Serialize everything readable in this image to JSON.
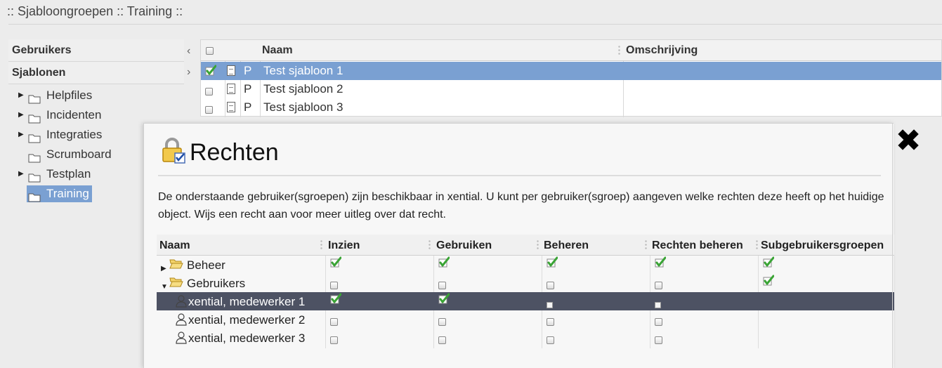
{
  "page": {
    "title": ":: Sjabloongroepen :: Training ::"
  },
  "nav": {
    "sections": [
      "Gebruikers",
      "Sjablonen"
    ],
    "items": [
      {
        "label": "Helpfiles",
        "expandable": true,
        "selected": false
      },
      {
        "label": "Incidenten",
        "expandable": true,
        "selected": false
      },
      {
        "label": "Integraties",
        "expandable": true,
        "selected": false
      },
      {
        "label": "Scrumboard",
        "expandable": false,
        "selected": false
      },
      {
        "label": "Testplan",
        "expandable": true,
        "selected": false
      },
      {
        "label": "Training",
        "expandable": false,
        "selected": true
      }
    ]
  },
  "grid": {
    "columns": {
      "name": "Naam",
      "description": "Omschrijving"
    },
    "rows": [
      {
        "type": "P",
        "name": "Test sjabloon 1",
        "description": "",
        "checked": true,
        "selected": true
      },
      {
        "type": "P",
        "name": "Test sjabloon 2",
        "description": "",
        "checked": false,
        "selected": false
      },
      {
        "type": "P",
        "name": "Test sjabloon 3",
        "description": "",
        "checked": false,
        "selected": false
      }
    ]
  },
  "modal": {
    "title": "Rechten",
    "description": "De onderstaande gebruiker(sgroepen) zijn beschikbaar in xential. U kunt per gebruiker(sgroep) aangeven welke rechten deze heeft op het huidige object. Wijs een recht aan voor meer uitleg over dat recht.",
    "close_icon": "close-icon",
    "columns": [
      "Naam",
      "Inzien",
      "Gebruiken",
      "Beheren",
      "Rechten beheren",
      "Subgebruikersgroepen"
    ],
    "rows": [
      {
        "kind": "group",
        "name": "Beheer",
        "expand": "collapsed",
        "rights": [
          "check",
          "check",
          "check",
          "check",
          "check"
        ],
        "selected": false
      },
      {
        "kind": "group",
        "name": "Gebruikers",
        "expand": "expanded",
        "rights": [
          "box",
          "box",
          "box",
          "box",
          "check"
        ],
        "selected": false
      },
      {
        "kind": "user",
        "name": "xential, medewerker 1",
        "rights": [
          "check",
          "check",
          "small",
          "small",
          "none"
        ],
        "selected": true
      },
      {
        "kind": "user",
        "name": "xential, medewerker 2",
        "rights": [
          "box",
          "box",
          "box",
          "box",
          "none"
        ],
        "selected": false
      },
      {
        "kind": "user",
        "name": "xential, medewerker 3",
        "rights": [
          "box",
          "box",
          "box",
          "box",
          "none"
        ],
        "selected": false
      }
    ],
    "colors": {
      "selected_row": "#4d5263",
      "check_green": "#3aa435"
    }
  }
}
